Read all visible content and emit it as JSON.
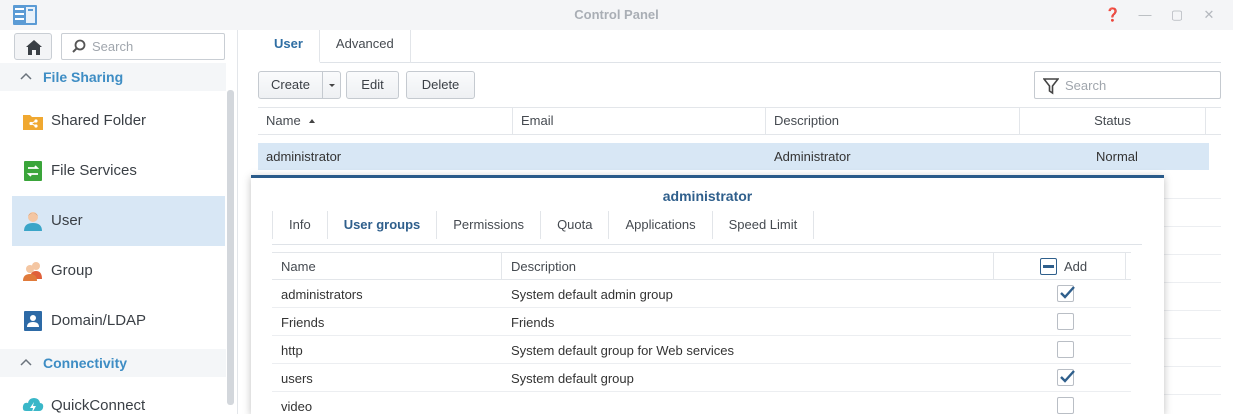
{
  "window": {
    "title": "Control Panel"
  },
  "sidebar": {
    "search_placeholder": "Search",
    "sections": [
      {
        "label": "File Sharing"
      },
      {
        "label": "Connectivity"
      }
    ],
    "items": [
      {
        "label": "Shared Folder",
        "icon": "shared-folder-icon"
      },
      {
        "label": "File Services",
        "icon": "file-services-icon"
      },
      {
        "label": "User",
        "icon": "user-icon",
        "active": true
      },
      {
        "label": "Group",
        "icon": "group-icon"
      },
      {
        "label": "Domain/LDAP",
        "icon": "domain-ldap-icon"
      },
      {
        "label": "QuickConnect",
        "icon": "quickconnect-icon"
      }
    ]
  },
  "main": {
    "tabs": [
      {
        "label": "User",
        "active": true
      },
      {
        "label": "Advanced"
      }
    ],
    "toolbar": {
      "create": "Create",
      "edit": "Edit",
      "delete": "Delete",
      "search_placeholder": "Search"
    },
    "columns": [
      "Name",
      "Email",
      "Description",
      "Status"
    ],
    "selected_row": {
      "name": "administrator",
      "email": "",
      "description": "Administrator",
      "status": "Normal"
    }
  },
  "popup": {
    "title": "administrator",
    "tabs": [
      {
        "label": "Info"
      },
      {
        "label": "User groups",
        "active": true
      },
      {
        "label": "Permissions"
      },
      {
        "label": "Quota"
      },
      {
        "label": "Applications"
      },
      {
        "label": "Speed Limit"
      }
    ],
    "columns": {
      "name": "Name",
      "description": "Description",
      "add": "Add"
    },
    "rows": [
      {
        "name": "administrators",
        "description": "System default admin group",
        "checked": true
      },
      {
        "name": "Friends",
        "description": "Friends",
        "checked": false
      },
      {
        "name": "http",
        "description": "System default group for Web services",
        "checked": false
      },
      {
        "name": "users",
        "description": "System default group",
        "checked": true
      },
      {
        "name": "video",
        "description": "",
        "checked": false
      }
    ]
  },
  "colors": {
    "accent": "#3e8dc4",
    "selection": "#d8e7f5",
    "popup_border": "#2a5b8a"
  }
}
